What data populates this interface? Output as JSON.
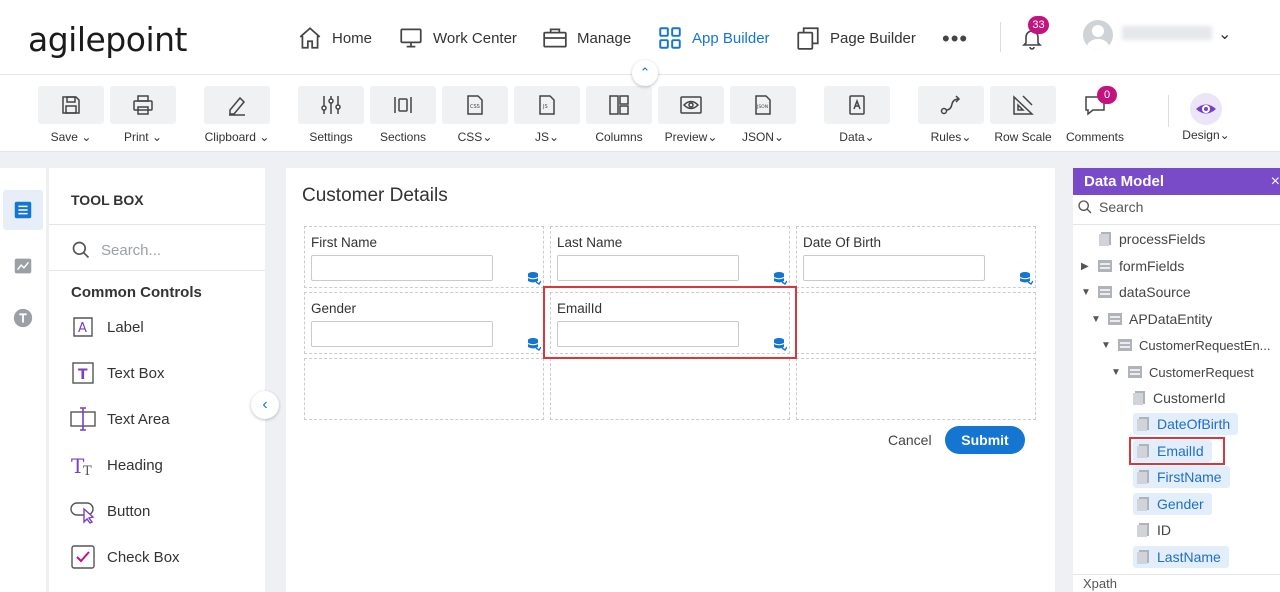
{
  "brand": {
    "logo": "agilepoint"
  },
  "nav": {
    "items": [
      {
        "label": "Home",
        "icon": "home-icon"
      },
      {
        "label": "Work Center",
        "icon": "monitor-icon"
      },
      {
        "label": "Manage",
        "icon": "briefcase-icon"
      },
      {
        "label": "App Builder",
        "icon": "grid-icon",
        "active": true
      },
      {
        "label": "Page Builder",
        "icon": "pages-icon"
      }
    ],
    "more": "•••",
    "notifications_count": "33",
    "accent_color": "#1576d2",
    "badge_color": "#c2137e"
  },
  "ribbon": {
    "save": "Save",
    "print": "Print",
    "clipboard": "Clipboard",
    "settings": "Settings",
    "sections": "Sections",
    "css": "CSS",
    "js": "JS",
    "columns": "Columns",
    "preview": "Preview",
    "json": "JSON",
    "data": "Data",
    "rules": "Rules",
    "row_scale": "Row Scale",
    "comments": "Comments",
    "comments_count": "0",
    "design": "Design"
  },
  "toolbox": {
    "title": "TOOL BOX",
    "search_placeholder": "Search...",
    "group": "Common Controls",
    "items": [
      "Label",
      "Text Box",
      "Text Area",
      "Heading",
      "Button",
      "Check Box"
    ]
  },
  "form": {
    "title": "Customer Details",
    "fields": {
      "first_name": "First Name",
      "last_name": "Last Name",
      "date_of_birth": "Date Of Birth",
      "gender": "Gender",
      "email": "EmailId"
    },
    "cancel": "Cancel",
    "submit": "Submit"
  },
  "data_model": {
    "title": "Data Model",
    "close": "×",
    "search": "Search",
    "nodes": {
      "process_fields": "processFields",
      "form_fields": "formFields",
      "data_source": "dataSource",
      "ap_data_entity": "APDataEntity",
      "customer_request_entity": "CustomerRequestEn...",
      "customer_request": "CustomerRequest",
      "customer_id": "CustomerId",
      "date_of_birth": "DateOfBirth",
      "email_id": "EmailId",
      "first_name": "FirstName",
      "gender": "Gender",
      "id": "ID",
      "last_name": "LastName"
    },
    "footer": "Xpath",
    "header_color": "#7a4bc9",
    "highlight_color": "#d9363e"
  }
}
